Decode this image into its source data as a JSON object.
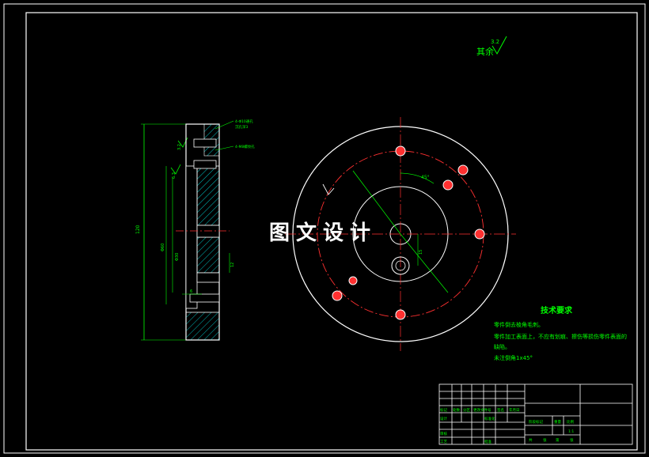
{
  "surface_roughness": {
    "label": "其余",
    "value": "3.2"
  },
  "tech_requirements": {
    "title": "技术要求",
    "lines": [
      "零件倒去棱角毛刺。",
      "零件加工表面上，不应有划痕、擦伤等损伤零件表面的",
      "缺陷。",
      "未注倒角1x45°"
    ]
  },
  "section_view_callouts": [
    "4-Φ10通孔",
    "沉孔深3",
    "4-M8螺纹孔"
  ],
  "section_view_dims": [
    "Φ60",
    "6.3",
    "Φ30",
    "3.2",
    "12",
    "6",
    "120"
  ],
  "face_view": {
    "angle_label": "45°",
    "vertical_dim": "15"
  },
  "title_block": {
    "row_labels": [
      "标记",
      "处数",
      "分区",
      "更改文件号",
      "签名",
      "年月日"
    ],
    "design_label": "设计",
    "standardized_label": "标准化",
    "review_label": "审核",
    "process_label": "工艺",
    "approve_label": "批准",
    "stage_label": "阶段标记",
    "weight_label": "重量",
    "scale_label": "比例",
    "scale_value": "1:1",
    "sheet_info": [
      "共",
      "张",
      "第",
      "张"
    ]
  },
  "watermark": "图文设计",
  "colors": {
    "background": "#000000",
    "frame": "#ffffff",
    "dimension": "#00ff00",
    "part_outline": "#ffffff",
    "hatch": "#00bcbc",
    "centerline": "#ff3030",
    "hole_fill": "#ff3030"
  }
}
